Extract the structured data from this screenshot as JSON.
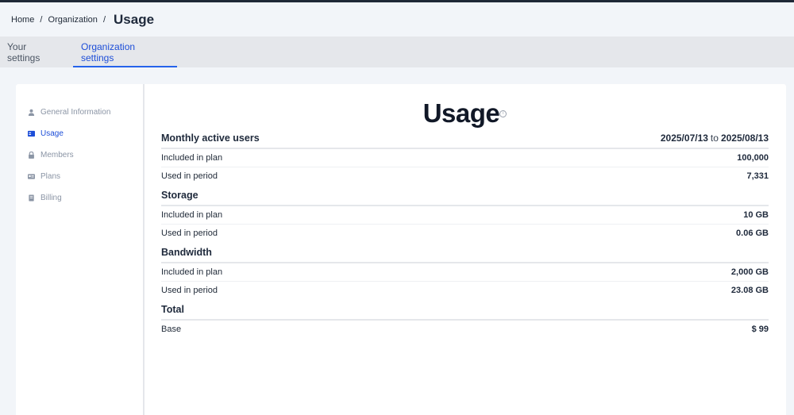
{
  "breadcrumb": {
    "home": "Home",
    "organization": "Organization",
    "sep": "/",
    "current": "Usage"
  },
  "tabs": [
    {
      "label": "Your settings",
      "active": false
    },
    {
      "label": "Organization settings",
      "active": true
    }
  ],
  "sidebar": {
    "items": [
      {
        "label": "General Information",
        "icon": "user-icon",
        "active": false
      },
      {
        "label": "Usage",
        "icon": "id-card-icon",
        "active": true
      },
      {
        "label": "Members",
        "icon": "lock-icon",
        "active": false
      },
      {
        "label": "Plans",
        "icon": "card-icon",
        "active": false
      },
      {
        "label": "Billing",
        "icon": "receipt-icon",
        "active": false
      }
    ]
  },
  "main": {
    "title": "Usage",
    "info": "i",
    "mau": {
      "title": "Monthly active users",
      "period_start": "2025/07/13",
      "period_to": "to",
      "period_end": "2025/08/13",
      "included_label": "Included in plan",
      "included_value": "100,000",
      "used_label": "Used in period",
      "used_value": "7,331"
    },
    "storage": {
      "title": "Storage",
      "included_label": "Included in plan",
      "included_value": "10 GB",
      "used_label": "Used in period",
      "used_value": "0.06 GB"
    },
    "bandwidth": {
      "title": "Bandwidth",
      "included_label": "Included in plan",
      "included_value": "2,000 GB",
      "used_label": "Used in period",
      "used_value": "23.08 GB"
    },
    "total": {
      "title": "Total",
      "base_label": "Base",
      "base_value": "$ 99"
    }
  },
  "colors": {
    "accent": "#1d4ed8",
    "muted": "#8b95a5",
    "page_bg": "#f2f5f9"
  }
}
